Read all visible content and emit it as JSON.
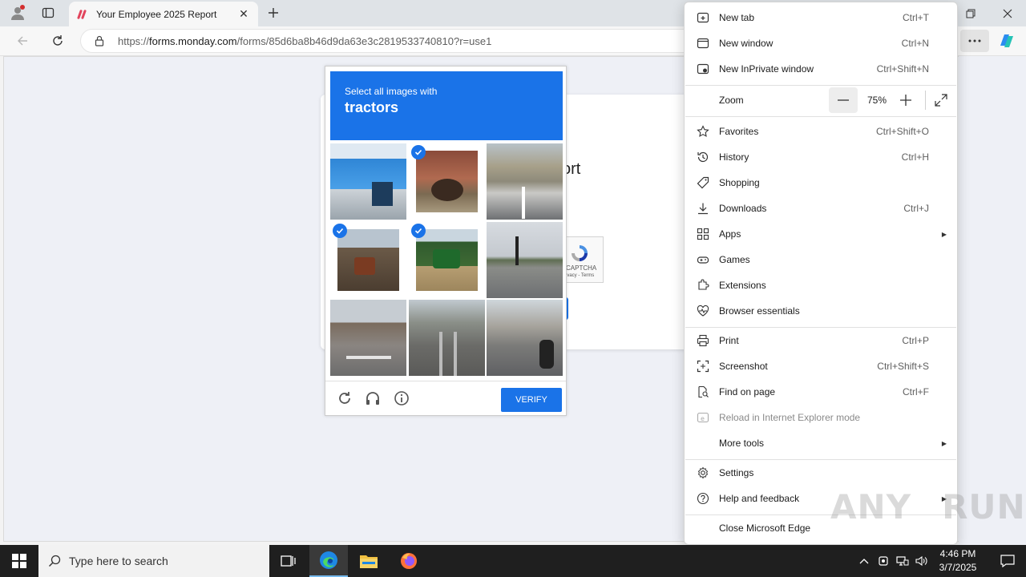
{
  "browser": {
    "tab_title": "Your Employee 2025 Report",
    "url_prefix": "https://",
    "url_domain": "forms.monday.com",
    "url_path": "/forms/85d6ba8b46d9da63e3c2819533740810?r=use1"
  },
  "page": {
    "form_title_partial": "ort",
    "recaptcha_label": "CAPTCHA",
    "recaptcha_terms": "ivacy - Terms"
  },
  "captcha": {
    "instruction": "Select all images with",
    "target": "tractors",
    "verify_label": "VERIFY",
    "tiles": [
      {
        "subject": "storefront",
        "selected": false
      },
      {
        "subject": "tractor",
        "selected": true
      },
      {
        "subject": "highway",
        "selected": false
      },
      {
        "subject": "tractor",
        "selected": true
      },
      {
        "subject": "tractor",
        "selected": true
      },
      {
        "subject": "intersection",
        "selected": false
      },
      {
        "subject": "street",
        "selected": false
      },
      {
        "subject": "tram-tracks",
        "selected": false
      },
      {
        "subject": "motorcycles",
        "selected": false
      }
    ]
  },
  "menu": {
    "zoom_label": "Zoom",
    "zoom_value": "75%",
    "items": [
      {
        "label": "New tab",
        "shortcut": "Ctrl+T",
        "icon": "new-tab-icon"
      },
      {
        "label": "New window",
        "shortcut": "Ctrl+N",
        "icon": "new-window-icon"
      },
      {
        "label": "New InPrivate window",
        "shortcut": "Ctrl+Shift+N",
        "icon": "inprivate-icon"
      },
      {
        "label": "Favorites",
        "shortcut": "Ctrl+Shift+O",
        "icon": "star-icon"
      },
      {
        "label": "History",
        "shortcut": "Ctrl+H",
        "icon": "history-icon"
      },
      {
        "label": "Shopping",
        "shortcut": "",
        "icon": "tag-icon"
      },
      {
        "label": "Downloads",
        "shortcut": "Ctrl+J",
        "icon": "download-icon"
      },
      {
        "label": "Apps",
        "shortcut": "",
        "icon": "apps-icon"
      },
      {
        "label": "Games",
        "shortcut": "",
        "icon": "games-icon"
      },
      {
        "label": "Extensions",
        "shortcut": "",
        "icon": "extensions-icon"
      },
      {
        "label": "Browser essentials",
        "shortcut": "",
        "icon": "heart-pulse-icon"
      },
      {
        "label": "Print",
        "shortcut": "Ctrl+P",
        "icon": "print-icon"
      },
      {
        "label": "Screenshot",
        "shortcut": "Ctrl+Shift+S",
        "icon": "screenshot-icon"
      },
      {
        "label": "Find on page",
        "shortcut": "Ctrl+F",
        "icon": "find-icon"
      },
      {
        "label": "Reload in Internet Explorer mode",
        "shortcut": "",
        "icon": "ie-icon"
      },
      {
        "label": "More tools",
        "shortcut": "",
        "icon": ""
      },
      {
        "label": "Settings",
        "shortcut": "",
        "icon": "gear-icon"
      },
      {
        "label": "Help and feedback",
        "shortcut": "",
        "icon": "help-icon"
      },
      {
        "label": "Close Microsoft Edge",
        "shortcut": "",
        "icon": ""
      }
    ]
  },
  "taskbar": {
    "search_placeholder": "Type here to search",
    "time": "4:46 PM",
    "date": "3/7/2025"
  },
  "watermark": "ANY RUN",
  "colors": {
    "accent": "#1a73e8",
    "taskbar": "#1f1f1f"
  }
}
